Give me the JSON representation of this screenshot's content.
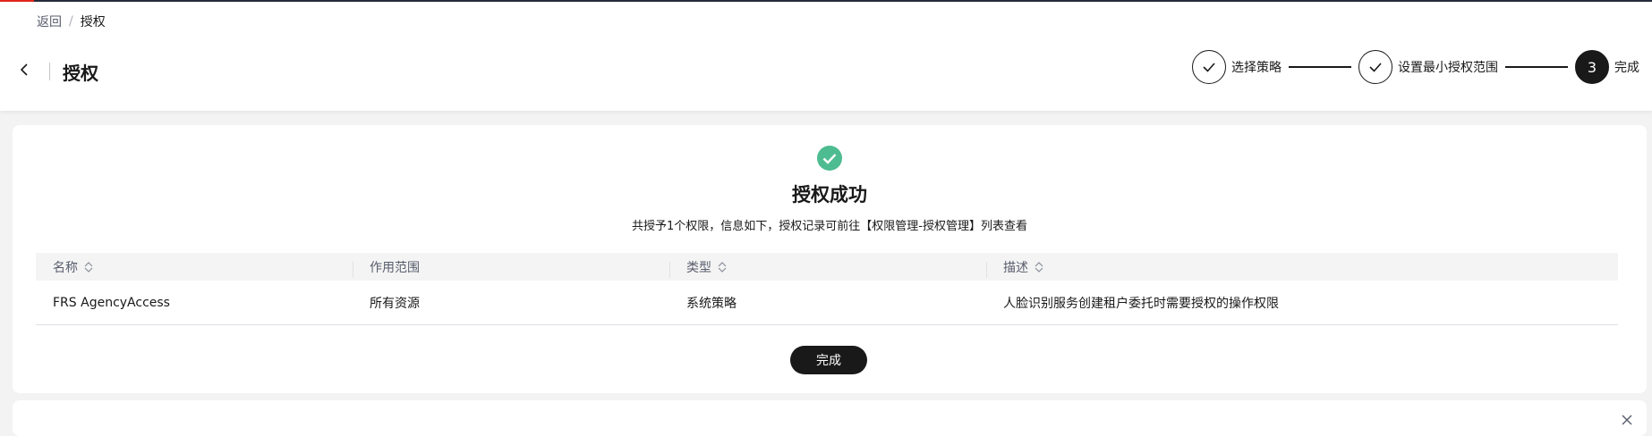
{
  "breadcrumb": {
    "back": "返回",
    "separator": "/",
    "current": "授权"
  },
  "header": {
    "title": "授权"
  },
  "steps": [
    {
      "label": "选择策略",
      "status": "done"
    },
    {
      "label": "设置最小授权范围",
      "status": "done"
    },
    {
      "number": "3",
      "label": "完成",
      "status": "current"
    }
  ],
  "result": {
    "title": "授权成功",
    "description": "共授予1个权限，信息如下，授权记录可前往【权限管理-授权管理】列表查看"
  },
  "table": {
    "columns": [
      "名称",
      "作用范围",
      "类型",
      "描述"
    ],
    "rows": [
      [
        "FRS AgencyAccess",
        "所有资源",
        "系统策略",
        "人脸识别服务创建租户委托时需要授权的操作权限"
      ]
    ]
  },
  "actions": {
    "done_label": "完成"
  },
  "colors": {
    "success": "#4ebc91",
    "primary": "#191919",
    "brand_accent": "#e1251b"
  },
  "icons": [
    "chevron-left-icon",
    "check-icon",
    "success-check-icon",
    "sort-icon",
    "close-icon"
  ]
}
